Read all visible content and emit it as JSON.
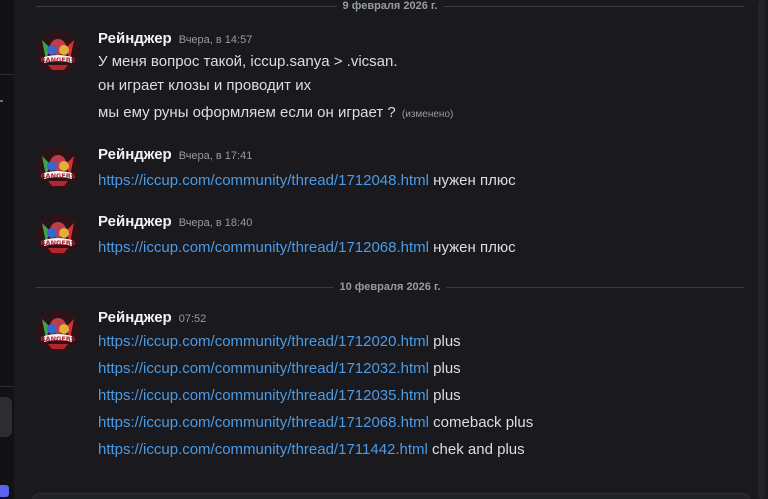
{
  "dividers": {
    "top_date": "9 февраля 2026 г.",
    "second_date": "10 февраля 2026 г."
  },
  "messages": [
    {
      "author": "Рейнджер",
      "time": "Вчера, в 14:57",
      "lines": [
        "У меня вопрос такой, iccup.sanya > .vicsan.",
        "он играет клозы  и проводит их",
        "мы ему руны оформляем если он играет ?"
      ],
      "edited_label": "(изменено)"
    },
    {
      "author": "Рейнджер",
      "time": "Вчера, в 17:41",
      "link": "https://iccup.com/community/thread/1712048.html",
      "suffix": " нужен плюс"
    },
    {
      "author": "Рейнджер",
      "time": "Вчера, в 18:40",
      "link": "https://iccup.com/community/thread/1712068.html",
      "suffix": " нужен плюс"
    },
    {
      "author": "Рейнджер",
      "time": "07:52",
      "items": [
        {
          "link": "https://iccup.com/community/thread/1712020.html",
          "suffix": " plus"
        },
        {
          "link": "https://iccup.com/community/thread/1712032.html",
          "suffix": " plus"
        },
        {
          "link": "https://iccup.com/community/thread/1712035.html",
          "suffix": " plus"
        },
        {
          "link": "https://iccup.com/community/thread/1712068.html",
          "suffix": " comeback plus"
        },
        {
          "link": "https://iccup.com/community/thread/1711442.html",
          "suffix": " chek and plus"
        }
      ]
    }
  ],
  "avatar_logo_text": "RANGERS",
  "colors": {
    "background": "#1a1a1e",
    "link": "#4b9be6",
    "username": "#f2f3f5",
    "text": "#dbdee1",
    "muted": "#949ba4"
  }
}
